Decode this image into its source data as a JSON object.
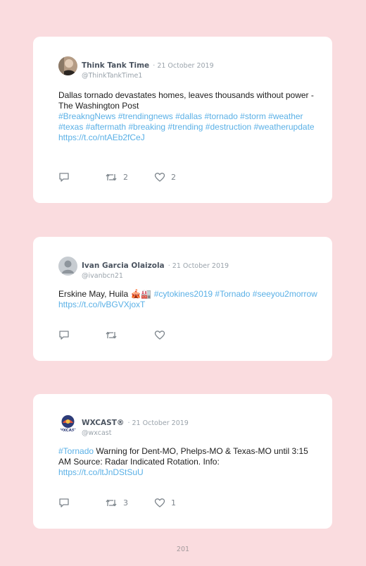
{
  "tweets": [
    {
      "author": "Think Tank Time",
      "date": "· 21 October 2019",
      "handle": "@ThinkTankTime1",
      "text_line1": "Dallas tornado devastates homes, leaves thousands without power - The Washington Post",
      "hashtags": "#BreakngNews #trendingnews #dallas #tornado #storm #weather #texas #aftermath #breaking #trending #destruction #weatherupdate",
      "link": "https://t.co/ntAEb2fCeJ",
      "retweets": "2",
      "likes": "2"
    },
    {
      "author": "Ivan Garcia Olaizola",
      "date": "· 21 October 2019",
      "handle": "@ivanbcn21",
      "text_plain": "Erskine May, Huila 🎪🏭",
      "hashtags": "#cytokines2019 #Tornado #seeyou2morrow",
      "link": "https://t.co/lvBGVXjoxT"
    },
    {
      "author": "WXCAST®",
      "date": "· 21 October 2019",
      "handle": "@wxcast",
      "hashtag": "#Tornado",
      "text_plain": "Warning for Dent-MO, Phelps-MO & Texas-MO until 3:15 AM Source: Radar Indicated Rotation. Info:",
      "link": "https://t.co/ltJnDStSuU",
      "retweets": "3",
      "likes": "1",
      "avatar_text": "WXCAST"
    }
  ],
  "page_number": "201",
  "colors": {
    "background": "#fadcdf",
    "card": "#ffffff",
    "link": "#5ab0e6",
    "icon": "#7d858c"
  },
  "icons": [
    "reply-icon",
    "retweet-icon",
    "like-icon"
  ]
}
